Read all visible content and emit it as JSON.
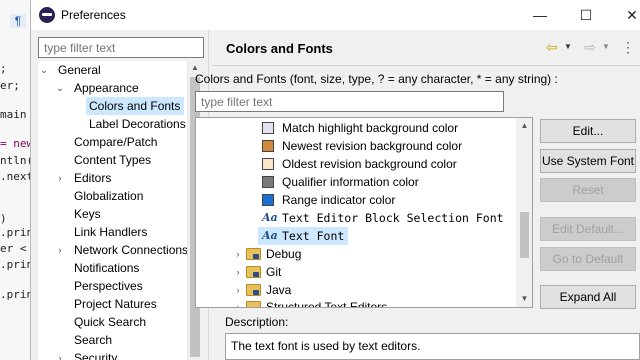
{
  "editor_bg": {
    "lines": [
      ";",
      "er;",
      "main",
      "= new",
      "ntln(",
      ".next",
      ")",
      ".prin",
      "er <",
      ".prin",
      ".prin"
    ]
  },
  "dialog": {
    "title": "Preferences",
    "minimize_glyph": "—",
    "maximize_glyph": "☐",
    "close_glyph": "✕"
  },
  "left": {
    "filter_placeholder": "type filter text",
    "tree": [
      {
        "label": "General",
        "expanded": true,
        "level": 0
      },
      {
        "label": "Appearance",
        "expanded": true,
        "level": 1
      },
      {
        "label": "Colors and Fonts",
        "selected": true,
        "level": 2
      },
      {
        "label": "Label Decorations",
        "level": 2
      },
      {
        "label": "Compare/Patch",
        "level": 1
      },
      {
        "label": "Content Types",
        "level": 1
      },
      {
        "label": "Editors",
        "expanded": false,
        "level": 1
      },
      {
        "label": "Globalization",
        "level": 1
      },
      {
        "label": "Keys",
        "level": 1
      },
      {
        "label": "Link Handlers",
        "level": 1
      },
      {
        "label": "Network Connections",
        "expanded": false,
        "level": 1
      },
      {
        "label": "Notifications",
        "level": 1
      },
      {
        "label": "Perspectives",
        "level": 1
      },
      {
        "label": "Project Natures",
        "level": 1
      },
      {
        "label": "Quick Search",
        "level": 1
      },
      {
        "label": "Search",
        "level": 1
      },
      {
        "label": "Security",
        "expanded": false,
        "level": 1
      }
    ]
  },
  "right": {
    "page_title": "Colors and Fonts",
    "nav_icons": {
      "back": "back-arrow-icon",
      "forward": "forward-arrow-icon",
      "menu": "view-menu-icon"
    },
    "label": "Colors and Fonts (font, size, type, ? = any character, * = any string) :",
    "filter_placeholder": "type filter text",
    "items": [
      {
        "kind": "color",
        "label": "Match highlight background color",
        "color": "#e6e0f5"
      },
      {
        "kind": "color",
        "label": "Newest revision background color",
        "color": "#d08a3c"
      },
      {
        "kind": "color",
        "label": "Oldest revision background color",
        "color": "#fbe6cc"
      },
      {
        "kind": "color",
        "label": "Qualifier information color",
        "color": "#7a7a7a"
      },
      {
        "kind": "color",
        "label": "Range indicator color",
        "color": "#1a6fd1"
      },
      {
        "kind": "font",
        "label": "Text Editor Block Selection Font",
        "icon": "Aa"
      },
      {
        "kind": "font",
        "label": "Text Font",
        "icon": "Aa",
        "selected": true
      },
      {
        "kind": "folder",
        "label": "Debug"
      },
      {
        "kind": "folder",
        "label": "Git"
      },
      {
        "kind": "folder",
        "label": "Java"
      },
      {
        "kind": "folder",
        "label": "Structured Text Editors"
      }
    ],
    "buttons": [
      {
        "label": "Edit...",
        "enabled": true
      },
      {
        "label": "Use System Font",
        "enabled": true
      },
      {
        "label": "Reset",
        "enabled": false
      },
      {
        "label": "Edit Default...",
        "enabled": false
      },
      {
        "label": "Go to Default",
        "enabled": false
      },
      {
        "label": "Expand All",
        "enabled": true
      }
    ],
    "description_label": "Description:",
    "description_text": "The text font is used by text editors."
  }
}
